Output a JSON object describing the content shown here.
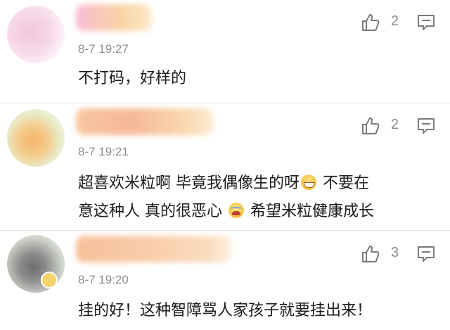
{
  "comments": [
    {
      "time": "8-7 19:27",
      "text": "不打码，好样的",
      "likes": "2",
      "like_icon": "thumbs-up-icon",
      "reply_icon": "comment-icon"
    },
    {
      "time": "8-7 19:21",
      "text_a": "超喜欢米粒啊 毕竟我偶像生的呀",
      "text_b": " 不要在",
      "text_c": "意这种人 真的很恶心",
      "text_d": " 希望米粒健康成长",
      "likes": "2",
      "like_icon": "thumbs-up-icon",
      "reply_icon": "comment-icon"
    },
    {
      "time": "8-7 19:20",
      "text": "挂的好！这种智障骂人家孩子就要挂出来！",
      "likes": "3",
      "like_icon": "thumbs-up-icon",
      "reply_icon": "comment-icon"
    }
  ],
  "colors": {
    "text": "#1b1b1b",
    "meta": "#8f8f8f",
    "divider": "#e7e7e7"
  }
}
